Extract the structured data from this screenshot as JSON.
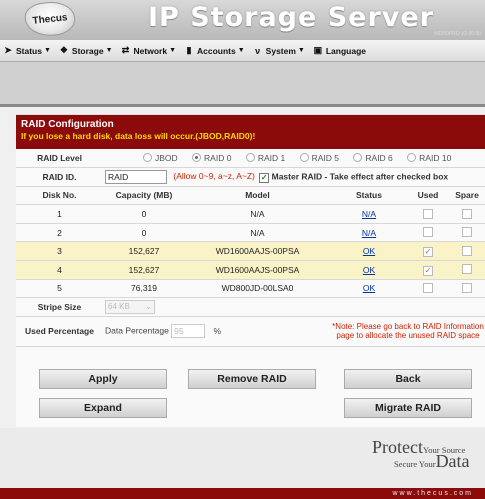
{
  "app": {
    "logo": "Thecus",
    "title": "IP Storage Server",
    "version": "N5200PRO V2.00.00"
  },
  "menu": [
    {
      "label": "Status",
      "icon": "display-icon"
    },
    {
      "label": "Storage",
      "icon": "disk-icon"
    },
    {
      "label": "Network",
      "icon": "network-icon"
    },
    {
      "label": "Accounts",
      "icon": "users-icon"
    },
    {
      "label": "System",
      "icon": "tools-icon"
    },
    {
      "label": "Language",
      "icon": "language-icon"
    }
  ],
  "raid": {
    "title": "RAID Configuration",
    "warning": "If you lose a hard disk, data loss will occur.(JBOD,RAID0)!",
    "level_label": "RAID Level",
    "levels": [
      "JBOD",
      "RAID 0",
      "RAID 1",
      "RAID 5",
      "RAID 6",
      "RAID 10"
    ],
    "selected_level": "RAID 0",
    "id_label": "RAID ID.",
    "id_value": "RAID",
    "id_hint": "(Allow 0~9, a~z, A~Z)",
    "master_label": "Master RAID - Take effect after checked box",
    "columns": [
      "Disk No.",
      "Capacity (MB)",
      "Model",
      "Status",
      "Used",
      "Spare"
    ],
    "disks": [
      {
        "no": "1",
        "capacity": "0",
        "model": "N/A",
        "status": "N/A",
        "used": false,
        "spare": false,
        "highlight": false
      },
      {
        "no": "2",
        "capacity": "0",
        "model": "N/A",
        "status": "N/A",
        "used": false,
        "spare": false,
        "highlight": false
      },
      {
        "no": "3",
        "capacity": "152,627",
        "model": "WD1600AAJS-00PSA",
        "status": "OK",
        "used": true,
        "spare": false,
        "highlight": true
      },
      {
        "no": "4",
        "capacity": "152,627",
        "model": "WD1600AAJS-00PSA",
        "status": "OK",
        "used": true,
        "spare": false,
        "highlight": true
      },
      {
        "no": "5",
        "capacity": "76,319",
        "model": "WD800JD-00LSA0",
        "status": "OK",
        "used": false,
        "spare": false,
        "highlight": false
      }
    ],
    "stripe_label": "Stripe Size",
    "stripe_value": "64 KB",
    "used_pct_label": "Used Percentage",
    "data_pct_label": "Data Percentage",
    "data_pct_value": "95",
    "pct_unit": "%",
    "note": "*Note: Please go back to RAID Information page to allocate the unused RAID space"
  },
  "buttons": {
    "apply": "Apply",
    "remove": "Remove RAID",
    "back": "Back",
    "expand": "Expand",
    "migrate": "Migrate RAID"
  },
  "footer": {
    "slogan_protect": "Protect",
    "slogan_your_source": "Your Source",
    "slogan_secure": "Secure Your",
    "slogan_data": "Data",
    "site": "www.thecus.com"
  }
}
